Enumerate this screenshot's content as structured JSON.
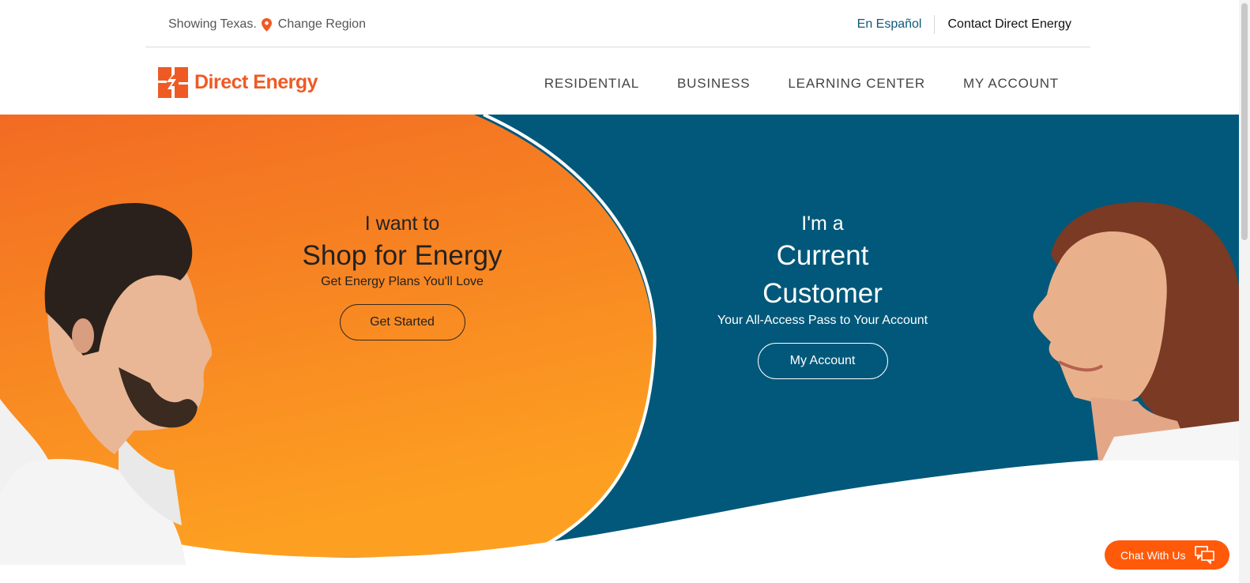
{
  "utility": {
    "showing_label": "Showing Texas.",
    "change_region_label": "Change Region",
    "spanish_link": "En Español",
    "contact_link": "Contact Direct Energy"
  },
  "brand": {
    "name": "Direct Energy",
    "icon": "direct-energy-logo-mark",
    "color": "#ef5a24"
  },
  "nav": {
    "items": [
      {
        "label": "RESIDENTIAL"
      },
      {
        "label": "BUSINESS"
      },
      {
        "label": "LEARNING CENTER"
      },
      {
        "label": "MY ACCOUNT"
      }
    ]
  },
  "hero": {
    "shop": {
      "kicker": "I want to",
      "headline": "Shop for Energy",
      "subtitle": "Get Energy Plans You'll Love",
      "button_label": "Get Started"
    },
    "customer": {
      "kicker": "I'm a",
      "headline_line1": "Current",
      "headline_line2": "Customer",
      "subtitle": "Your All-Access Pass to Your Account",
      "button_label": "My Account"
    },
    "colors": {
      "orange_top": "#f26b23",
      "orange_bottom": "#fda021",
      "teal": "#02587a"
    }
  },
  "chat": {
    "label": "Chat With Us",
    "icon": "chat-bubbles-icon",
    "color": "#ff5a0a"
  }
}
